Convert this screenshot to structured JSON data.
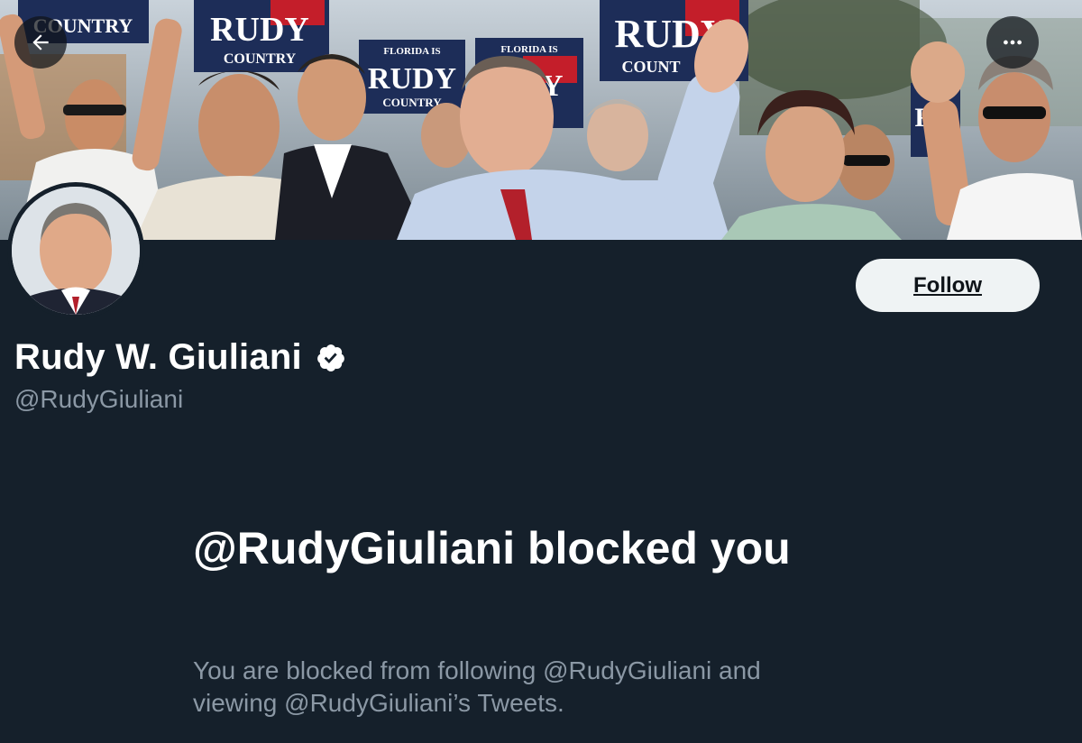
{
  "profile": {
    "display_name": "Rudy W. Giuliani",
    "handle": "@RudyGiuliani",
    "verified": true
  },
  "banner": {
    "description": "Campaign rally photo",
    "signs": {
      "rudy_country": "RUDY",
      "country": "COUNTRY",
      "florida_is": "FLORIDA IS",
      "rudy_country_caps": "COUNTRY"
    }
  },
  "actions": {
    "back_icon": "arrow-left-icon",
    "more_icon": "more-horizontal-icon",
    "follow_label": "Follow"
  },
  "blocked": {
    "title": "@RudyGiuliani blocked you",
    "message": "You are blocked from following @RudyGiuliani and viewing @RudyGiuliani’s Tweets."
  },
  "colors": {
    "background": "#15202b",
    "text_primary": "#ffffff",
    "text_secondary": "#8b98a5",
    "button_bg": "#eff3f4",
    "button_text": "#0f1419"
  }
}
